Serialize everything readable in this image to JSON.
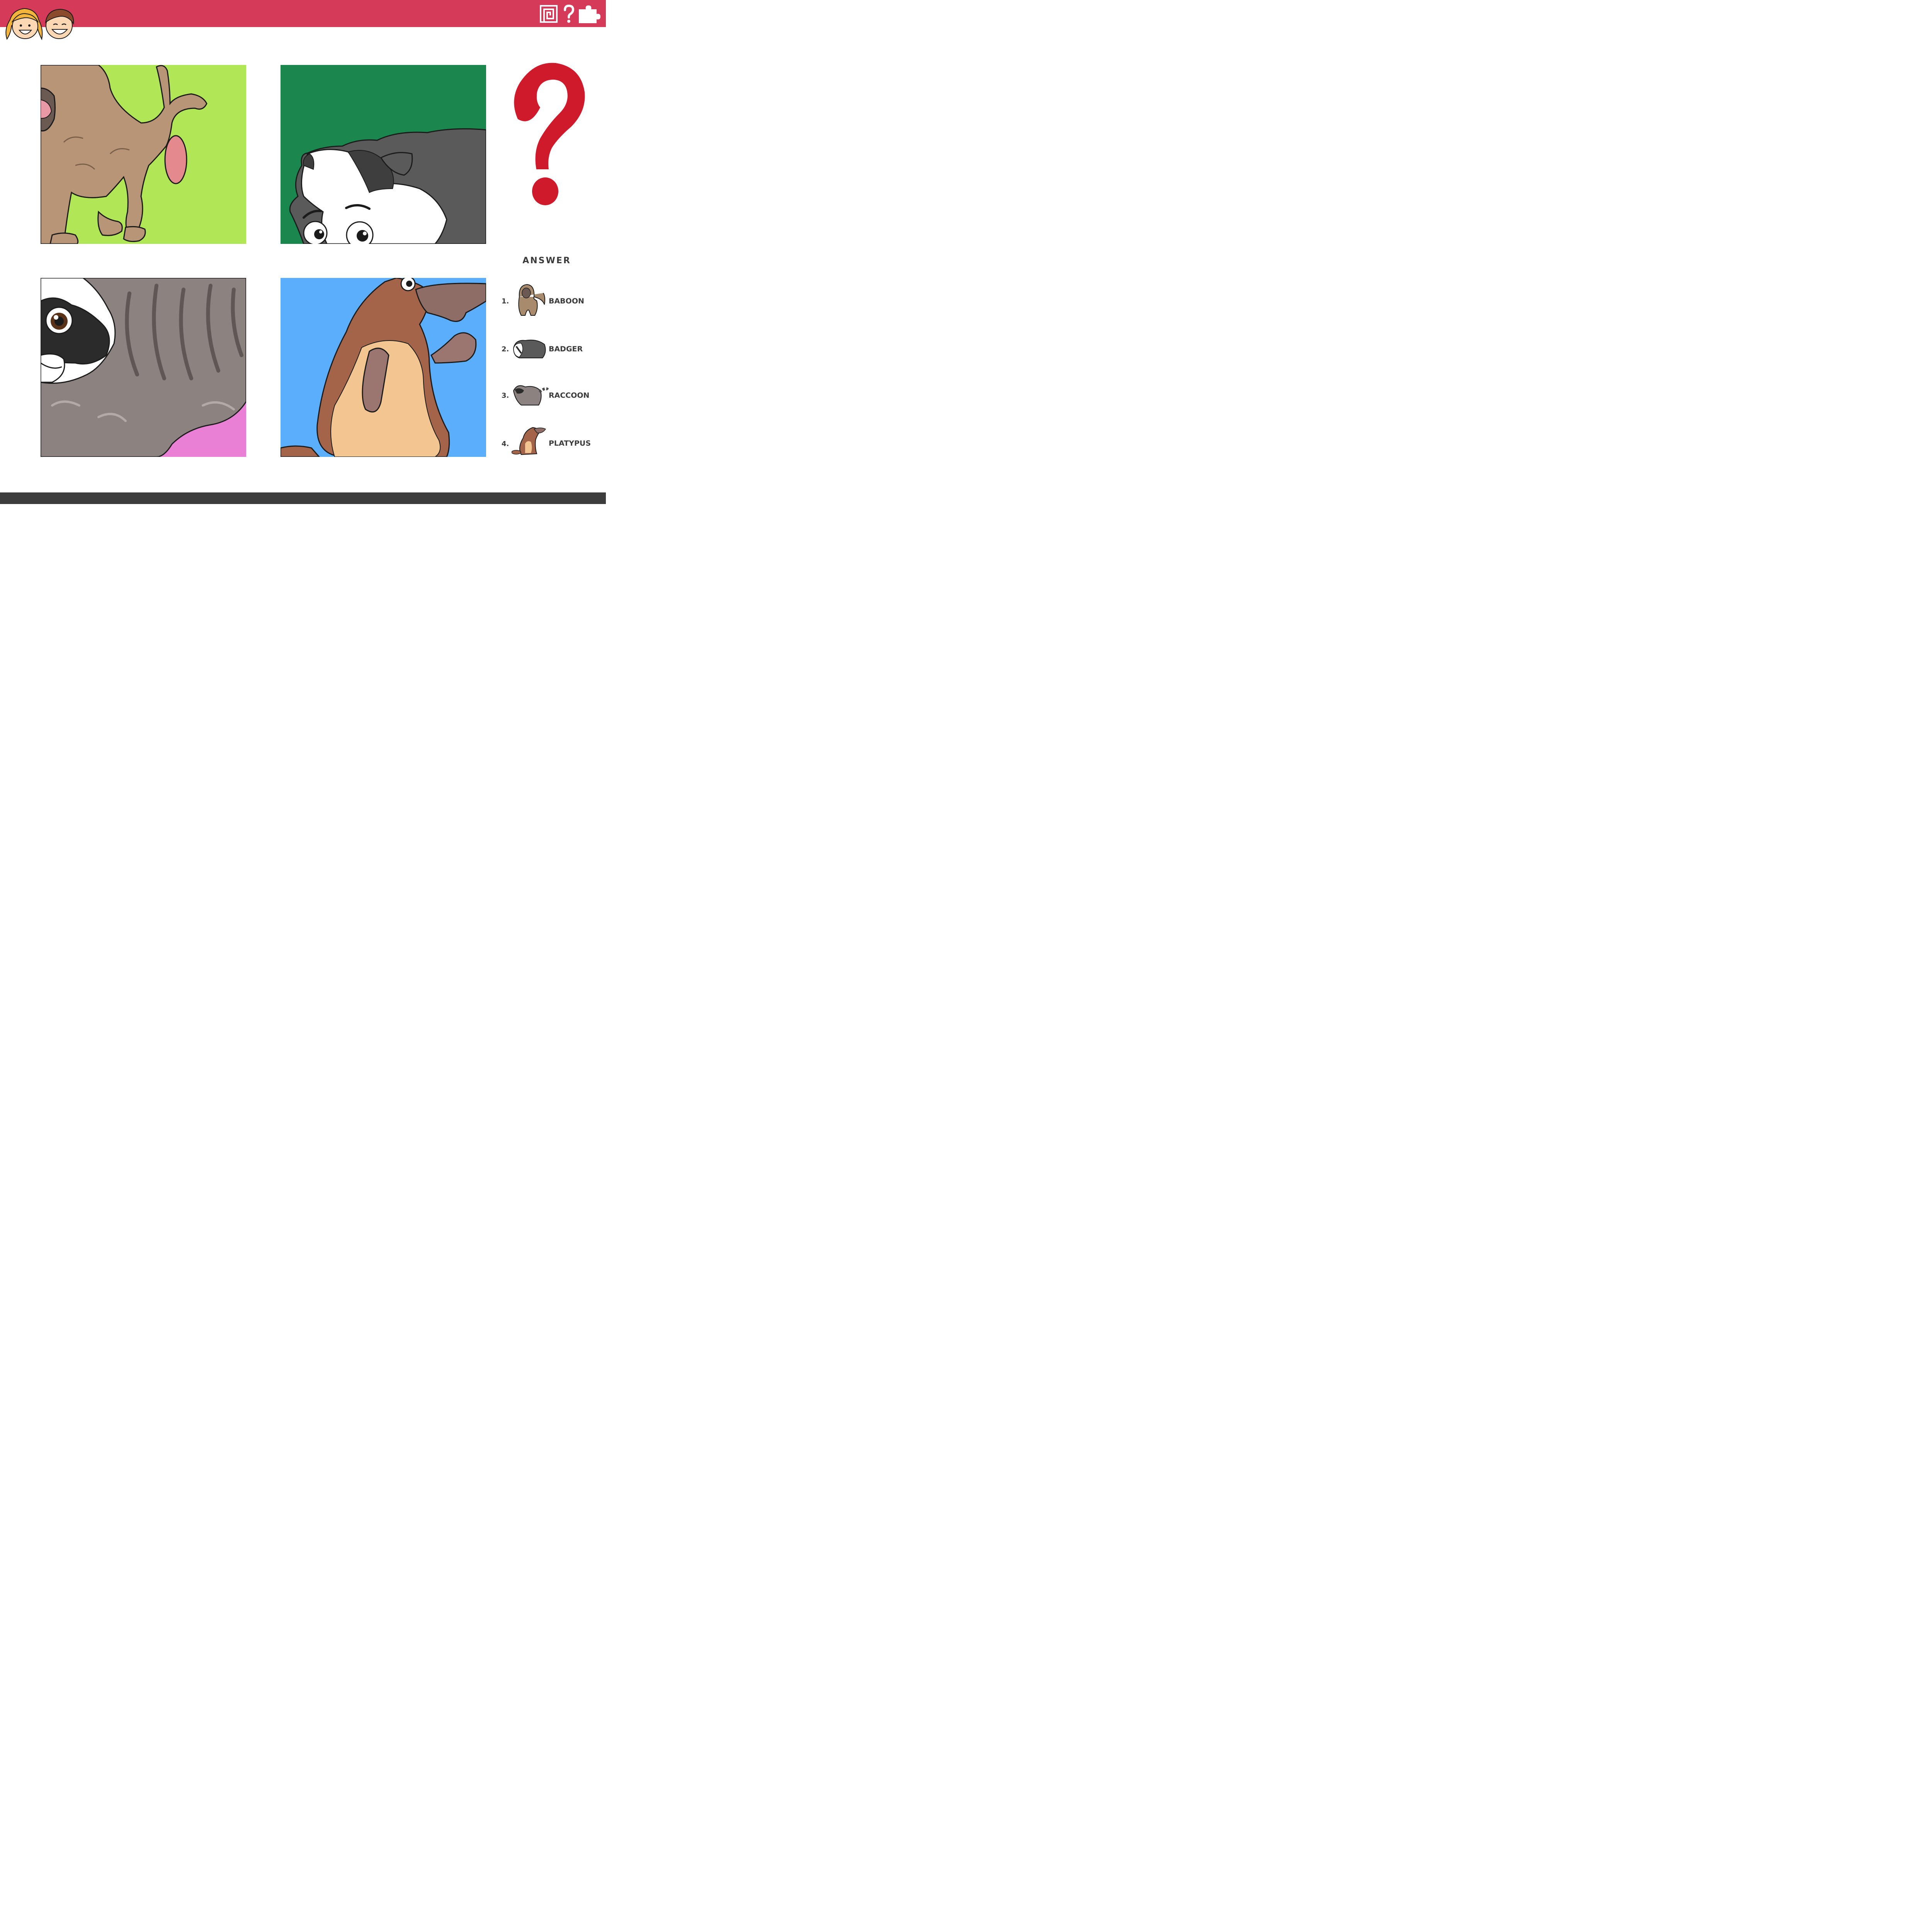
{
  "colors": {
    "header": "#d53a58",
    "footer": "#3d3d3d",
    "question_mark": "#cf1a2c",
    "panel_backgrounds": [
      "#b1e657",
      "#1a874f",
      "#ea7fd6",
      "#5aaefc"
    ]
  },
  "header": {
    "icons": [
      "kids-logo-icon",
      "maze-icon",
      "question-icon",
      "puzzle-icon"
    ]
  },
  "panels": [
    {
      "subject": "baboon-closeup"
    },
    {
      "subject": "badger-closeup"
    },
    {
      "subject": "raccoon-closeup"
    },
    {
      "subject": "platypus-closeup"
    }
  ],
  "answer": {
    "title": "ANSWER",
    "items": [
      {
        "number": "1.",
        "name": "BABOON"
      },
      {
        "number": "2.",
        "name": "BADGER"
      },
      {
        "number": "3.",
        "name": "RACCOON"
      },
      {
        "number": "4.",
        "name": "PLATYPUS"
      }
    ]
  }
}
